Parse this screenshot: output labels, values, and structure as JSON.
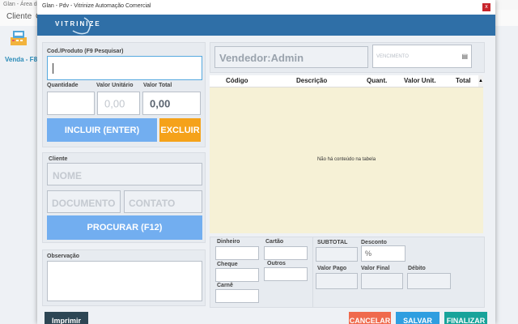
{
  "background": {
    "titlebar": "Glan - Área de Trabalho",
    "menu": [
      "Cliente",
      "C"
    ],
    "venda_label": "Venda - F8"
  },
  "window": {
    "title": "Glan - Pdv - Vitrinize Automação Comercial",
    "close": "x",
    "logo": "VITRINIZE"
  },
  "product": {
    "code_label": "Cod./Produto (F9 Pesquisar)",
    "quantity_label": "Quantidade",
    "unit_price_label": "Valor Unitário",
    "total_label": "Valor Total",
    "unit_price_value": "0,00",
    "total_value": "0,00",
    "include_button": "INCLUIR (ENTER)",
    "exclude_button": "EXCLUIR"
  },
  "client": {
    "section_label": "Cliente",
    "name_placeholder": "NOME",
    "document_placeholder": "DOCUMENTO",
    "contact_placeholder": "CONTATO",
    "search_button": "PROCURAR (F12)"
  },
  "observation": {
    "label": "Observação"
  },
  "seller": {
    "text": "Vendedor:Admin",
    "due_placeholder": "VENCIMENTO"
  },
  "grid": {
    "columns": [
      "Código",
      "Descrição",
      "Quant.",
      "Valor Unit.",
      "Total"
    ],
    "empty_message": "Não há conteúdo na tabela"
  },
  "payment": {
    "cash": "Dinheiro",
    "card": "Cartão",
    "check": "Cheque",
    "others": "Outros",
    "booklet": "Carnê",
    "subtotal": "SUBTOTAL",
    "discount": "Desconto",
    "discount_suffix": "%",
    "amount_paid": "Valor Pago",
    "final_value": "Valor Final",
    "debit": "Débito"
  },
  "actions": {
    "print": "Imprimir",
    "cancel": "CANCELAR",
    "save": "SALVAR",
    "finish": "FINALIZAR"
  },
  "colors": {
    "banner": "#2f6fa7",
    "primary_button": "#72aef0",
    "exclude_button": "#f5a21a",
    "cancel_button": "#ef6a4d",
    "save_button": "#2f9ee0",
    "finish_button": "#18a39a",
    "print_button": "#2d4654",
    "grid_background": "#f6f1d6"
  }
}
